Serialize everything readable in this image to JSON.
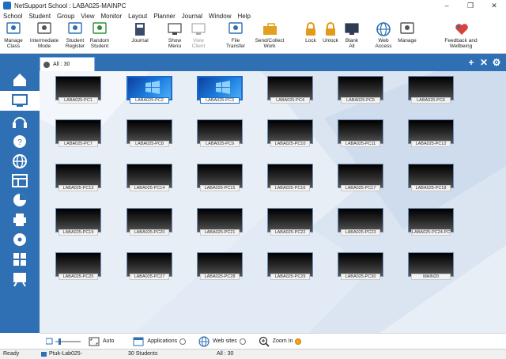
{
  "window": {
    "title": "NetSupport School : LABA025-MAINPC",
    "minimize": "–",
    "maximize": "❐",
    "close": "✕"
  },
  "menu": [
    "School",
    "Student",
    "Group",
    "View",
    "Monitor",
    "Layout",
    "Planner",
    "Journal",
    "Window",
    "Help"
  ],
  "toolbar": [
    {
      "label": "Manage\nClass",
      "icon": "manage-class-icon"
    },
    {
      "label": "Intermediate\nMode",
      "icon": "intermediate-mode-icon"
    },
    {
      "label": "Student\nRegister",
      "icon": "student-register-icon"
    },
    {
      "label": "Random\nStudent",
      "icon": "random-student-icon"
    },
    {
      "label": "Journal",
      "icon": "journal-icon"
    },
    {
      "label": "Show\nMenu",
      "icon": "show-menu-icon"
    },
    {
      "label": "View\nClient",
      "icon": "view-client-icon",
      "disabled": true
    },
    {
      "label": "File\nTransfer",
      "icon": "file-transfer-icon"
    },
    {
      "label": "Send/Collect\nWork",
      "icon": "send-collect-icon"
    },
    {
      "label": "Lock",
      "icon": "lock-icon"
    },
    {
      "label": "Unlock",
      "icon": "unlock-icon"
    },
    {
      "label": "Blank\nAll",
      "icon": "blank-all-icon"
    },
    {
      "label": "Web\nAccess",
      "icon": "web-access-icon"
    },
    {
      "label": "Manage",
      "icon": "manage-icon"
    },
    {
      "label": "Feedback and\nWellbeing",
      "icon": "feedback-icon"
    }
  ],
  "tab": {
    "label": "All : 30"
  },
  "tab_actions": {
    "add": "+",
    "close": "✕",
    "settings": "⚙"
  },
  "sidebar": [
    "home-icon",
    "monitor-icon",
    "headset-icon",
    "help-request-icon",
    "globe-icon",
    "layout-icon",
    "pie-chart-icon",
    "printer-icon",
    "media-icon",
    "quiz-icon",
    "whiteboard-icon"
  ],
  "computers": [
    {
      "name": "LABA025-PC1",
      "desktop": false
    },
    {
      "name": "LABA025-PC2",
      "desktop": true
    },
    {
      "name": "LABA025-PC3",
      "desktop": true
    },
    {
      "name": "LABA025-PC4",
      "desktop": false
    },
    {
      "name": "LABA025-PC5",
      "desktop": false
    },
    {
      "name": "LABA025-PC6",
      "desktop": false
    },
    {
      "name": "LABA025-PC7",
      "desktop": false
    },
    {
      "name": "LABA025-PC8",
      "desktop": false
    },
    {
      "name": "LABA025-PC9",
      "desktop": false
    },
    {
      "name": "LABA025-PC10",
      "desktop": false
    },
    {
      "name": "LABA025-PC11",
      "desktop": false
    },
    {
      "name": "LABA025-PC12",
      "desktop": false
    },
    {
      "name": "LABA025-PC13",
      "desktop": false
    },
    {
      "name": "LABA025-PC14",
      "desktop": false
    },
    {
      "name": "LABA025-PC15",
      "desktop": false
    },
    {
      "name": "LABA025-PC16",
      "desktop": false
    },
    {
      "name": "LABA025-PC17",
      "desktop": false
    },
    {
      "name": "LABA025-PC18",
      "desktop": false
    },
    {
      "name": "LABA025-PC19",
      "desktop": false
    },
    {
      "name": "LABA025-PC20",
      "desktop": false
    },
    {
      "name": "LABA025-PC21",
      "desktop": false
    },
    {
      "name": "LABA025-PC22",
      "desktop": false
    },
    {
      "name": "LABA025-PC23",
      "desktop": false
    },
    {
      "name": "LABA025-PC24-PC",
      "desktop": false
    },
    {
      "name": "LABA025-PC25",
      "desktop": false
    },
    {
      "name": "LABA025-PC27",
      "desktop": false
    },
    {
      "name": "LABA025-PC28",
      "desktop": false
    },
    {
      "name": "LABA025-PC29",
      "desktop": false
    },
    {
      "name": "LABA025-PC30",
      "desktop": false
    },
    {
      "name": "MAIN20",
      "desktop": false
    }
  ],
  "bottom": {
    "auto_label": "Auto",
    "applications_label": "Applications",
    "websites_label": "Web sites",
    "zoom_label": "Zoom In"
  },
  "status": {
    "ready": "Ready",
    "computer": "Ptuk-Lab025-",
    "students": "30 Students",
    "all": "All : 30"
  },
  "colors": {
    "accent": "#2f6fb3",
    "zoom_radio": "#f2a51a"
  }
}
